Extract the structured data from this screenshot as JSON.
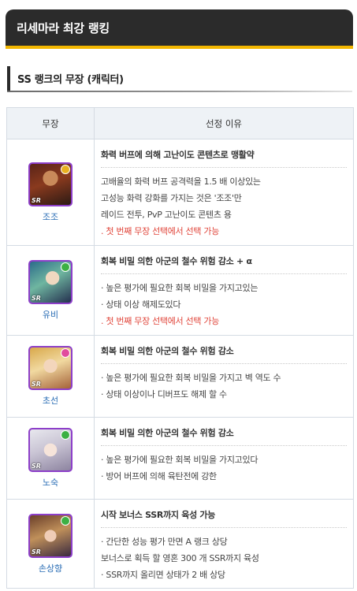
{
  "page": {
    "title": "리세마라 최강 랭킹",
    "section_title": "SS 랭크의 무장 (캐릭터)"
  },
  "table": {
    "headers": [
      "무장",
      "선정 이유"
    ],
    "rows": [
      {
        "name": "조조",
        "badge": "SR",
        "headline": "화력 버프에 의해 고난이도 콘텐츠로 맹활약",
        "lines": [
          {
            "text": "고배율의 화력 버프 공격력을 1.5 배 이상있는",
            "red": false
          },
          {
            "text": "고성능 화력 강화를 가지는 것은 '조조'만",
            "red": false
          },
          {
            "text": "레이드 전투, PvP 고난이도 콘텐츠 용",
            "red": false
          },
          {
            "text": ". 첫 번째 무장 선택에서 선택 가능",
            "red": true
          }
        ]
      },
      {
        "name": "유비",
        "badge": "SR",
        "headline": "회복 비밀 의한 아군의 철수 위험 감소 + α",
        "lines": [
          {
            "text": "· 높은 평가에 필요한 회복 비밀을 가지고있는",
            "red": false
          },
          {
            "text": "· 상태 이상 해제도있다",
            "red": false
          },
          {
            "text": ". 첫 번째 무장 선택에서 선택 가능",
            "red": true
          }
        ]
      },
      {
        "name": "초선",
        "badge": "SR",
        "headline": "회복 비밀 의한 아군의 철수 위험 감소",
        "lines": [
          {
            "text": "· 높은 평가에 필요한 회복 비밀을 가지고 벽 역도 수",
            "red": false
          },
          {
            "text": "· 상태 이상이나 디버프도 해제 할 수",
            "red": false
          }
        ]
      },
      {
        "name": "노숙",
        "badge": "SR",
        "headline": "회복 비밀 의한 아군의 철수 위험 감소",
        "lines": [
          {
            "text": "· 높은 평가에 필요한 회복 비밀을 가지고있다",
            "red": false
          },
          {
            "text": "· 방어 버프에 의해 육탄전에 강한",
            "red": false
          }
        ]
      },
      {
        "name": "손상향",
        "badge": "SR",
        "headline": "시작 보너스 SSR까지 육성 가능",
        "lines": [
          {
            "text": "· 간단한 성능 평가 만면 A 랭크 상당",
            "red": false
          },
          {
            "text": "보너스로 획득 할 영혼 300 개 SSR까지 육성",
            "red": false
          },
          {
            "text": "· SSR까지 올리면 상태가 2 배 상당",
            "red": false
          }
        ]
      }
    ]
  }
}
